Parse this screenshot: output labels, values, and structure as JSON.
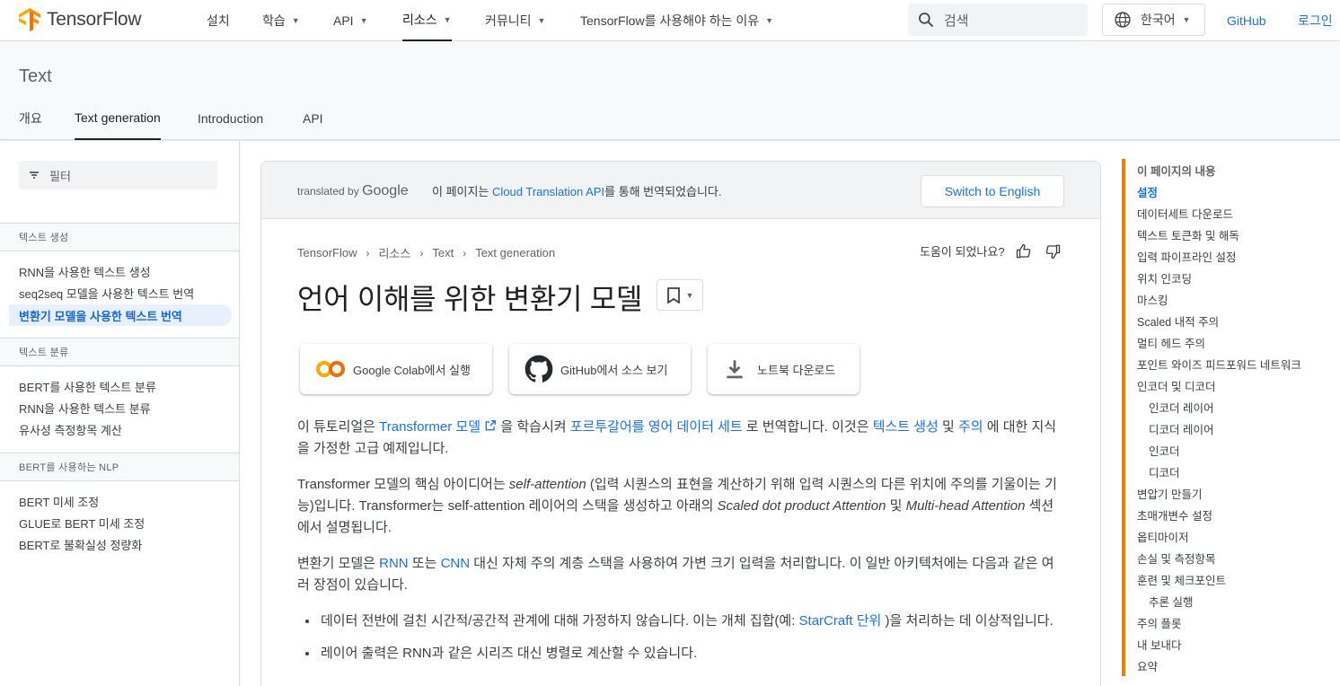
{
  "topnav": {
    "logo_text": "TensorFlow",
    "items": [
      {
        "label": "설치",
        "caret": false,
        "active": false
      },
      {
        "label": "학습",
        "caret": true,
        "active": false
      },
      {
        "label": "API",
        "caret": true,
        "active": false
      },
      {
        "label": "리소스",
        "caret": true,
        "active": true
      },
      {
        "label": "커뮤니티",
        "caret": true,
        "active": false
      },
      {
        "label": "TensorFlow를 사용해야 하는 이유",
        "caret": true,
        "active": false
      }
    ],
    "search_placeholder": "검색",
    "language": "한국어",
    "github": "GitHub",
    "login": "로그인"
  },
  "subheader": {
    "title": "Text",
    "tabs": [
      "개요",
      "Text generation",
      "Introduction",
      "API"
    ],
    "active_tab": "Text generation"
  },
  "sidebar": {
    "filter_placeholder": "필터",
    "sections": [
      {
        "title": "텍스트 생성",
        "items": [
          "RNN을 사용한 텍스트 생성",
          "seq2seq 모델을 사용한 텍스트 번역",
          "변환기 모델을 사용한 텍스트 번역"
        ]
      },
      {
        "title": "텍스트 분류",
        "items": [
          "BERT를 사용한 텍스트 분류",
          "RNN을 사용한 텍스트 분류",
          "유사성 측정항목 계산"
        ]
      },
      {
        "title": "BERT를 사용하는 NLP",
        "items": [
          "BERT 미세 조정",
          "GLUE로 BERT 미세 조정",
          "BERT로 불확실성 정량화"
        ]
      }
    ],
    "active_item": "변환기 모델을 사용한 텍스트 번역"
  },
  "translation_bar": {
    "translated_by": "translated by",
    "google": "Google",
    "msg_prefix": "이 페이지는 ",
    "msg_link": "Cloud Translation API",
    "msg_suffix": "를 통해 번역되었습니다.",
    "switch_label": "Switch to English"
  },
  "breadcrumb": [
    "TensorFlow",
    "리소스",
    "Text",
    "Text generation"
  ],
  "helpful_label": "도움이 되었나요?",
  "page_title": "언어 이해를 위한 변환기 모델",
  "action_buttons": [
    {
      "label": "Google Colab에서 실행",
      "icon": "colab-icon"
    },
    {
      "label": "GitHub에서 소스 보기",
      "icon": "github-icon"
    },
    {
      "label": "노트북 다운로드",
      "icon": "download-icon"
    }
  ],
  "content": {
    "p1": {
      "t1": "이 튜토리얼은 ",
      "link1": "Transformer 모델",
      "t2": " 을 학습시켜 ",
      "link2": "포르투갈어를 영어 데이터 세트",
      "t3": " 로 번역합니다. 이것은 ",
      "link3": "텍스트 생성",
      "t4": " 및 ",
      "link4": "주의",
      "t5": " 에 대한 지식을 가정한 고급 예제입니다."
    },
    "p2": {
      "t1": "Transformer 모델의 핵심 아이디어는 ",
      "em1": "self-attention",
      "t2": " (입력 시퀀스의 표현을 계산하기 위해 입력 시퀀스의 다른 위치에 주의를 기울이는 기능)입니다. Transformer는 self-attention 레이어의 스택을 생성하고 아래의 ",
      "em2": "Scaled dot product Attention",
      "t3": " 및 ",
      "em3": "Multi-head Attention",
      "t4": " 섹션에서 설명됩니다."
    },
    "p3": {
      "t1": "변환기 모델은 ",
      "link1": "RNN",
      "t2": " 또는 ",
      "link2": "CNN",
      "t3": " 대신 자체 주의 계층 스택을 사용하여 가변 크기 입력을 처리합니다. 이 일반 아키텍처에는 다음과 같은 여러 장점이 있습니다."
    },
    "bullet1": {
      "t1": "데이터 전반에 걸친 시간적/공간적 관계에 대해 가정하지 않습니다. 이는 개체 집합(예: ",
      "link1": "StarCraft 단위",
      "t2": " )을 처리하는 데 이상적입니다."
    },
    "bullet2": "레이어 출력은 RNN과 같은 시리즈 대신 병렬로 계산할 수 있습니다."
  },
  "toc": {
    "heading": "이 페이지의 내용",
    "items": [
      {
        "label": "설정",
        "level": 0,
        "current": true
      },
      {
        "label": "데이터세트 다운로드",
        "level": 0
      },
      {
        "label": "텍스트 토큰화 및 해독",
        "level": 0
      },
      {
        "label": "입력 파이프라인 설정",
        "level": 0
      },
      {
        "label": "위치 인코딩",
        "level": 0
      },
      {
        "label": "마스킹",
        "level": 0
      },
      {
        "label": "Scaled 내적 주의",
        "level": 0
      },
      {
        "label": "멀티 헤드 주의",
        "level": 0
      },
      {
        "label": "포인트 와이즈 피드포워드 네트워크",
        "level": 0
      },
      {
        "label": "인코더 및 디코더",
        "level": 0
      },
      {
        "label": "인코더 레이어",
        "level": 1
      },
      {
        "label": "디코더 레이어",
        "level": 1
      },
      {
        "label": "인코더",
        "level": 1
      },
      {
        "label": "디코더",
        "level": 1
      },
      {
        "label": "변압기 만들기",
        "level": 0
      },
      {
        "label": "초매개변수 설정",
        "level": 0
      },
      {
        "label": "옵티마이저",
        "level": 0
      },
      {
        "label": "손실 및 측정항목",
        "level": 0
      },
      {
        "label": "훈련 및 체크포인트",
        "level": 0
      },
      {
        "label": "추론 실행",
        "level": 1
      },
      {
        "label": "주의 플롯",
        "level": 0
      },
      {
        "label": "내 보내다",
        "level": 0
      },
      {
        "label": "요약",
        "level": 0
      }
    ]
  },
  "colors": {
    "accent_blue": "#1a73e8",
    "tf_orange": "#f57c00",
    "active_bg": "#e8f0fe"
  }
}
